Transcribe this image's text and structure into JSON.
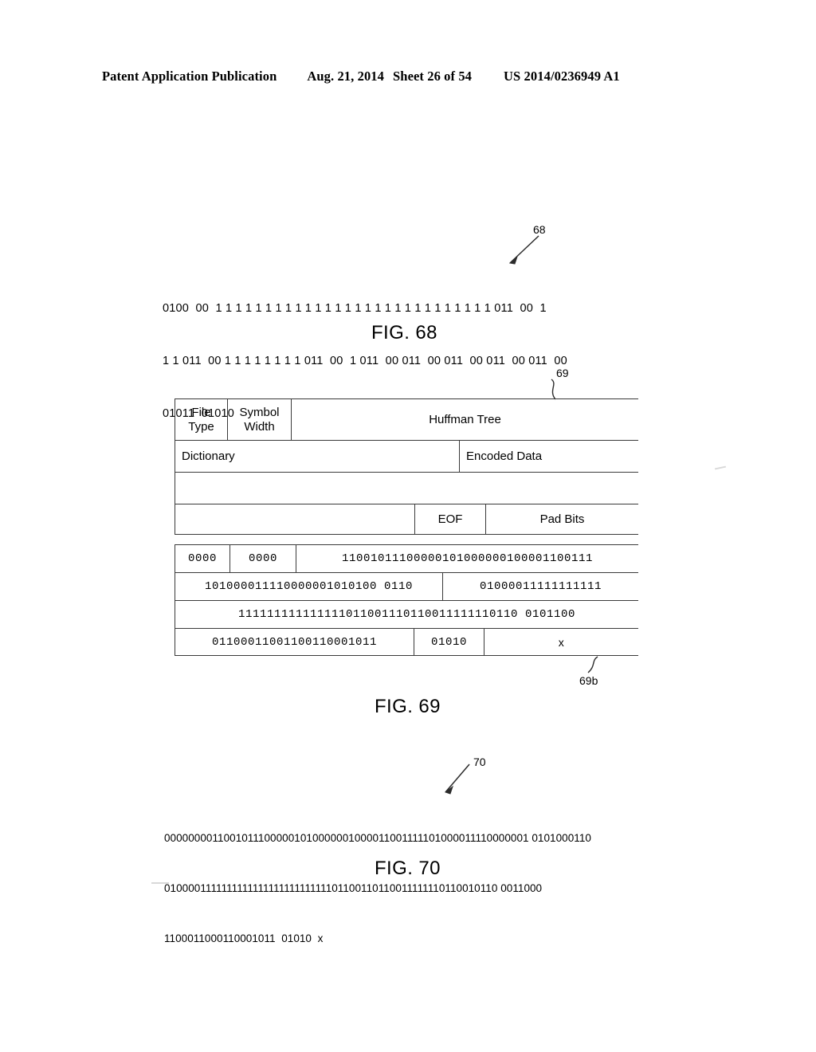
{
  "header": {
    "publication": "Patent Application Publication",
    "date": "Aug. 21, 2014",
    "sheet": "Sheet 26 of 54",
    "patent_number": "US 2014/0236949 A1"
  },
  "figures": [
    {
      "id": "fig68",
      "caption": "FIG. 68",
      "ref_numeral": "68",
      "type": "bit-stream",
      "lines": [
        "0100  00  1 1 1 1 1 1 1 1 1 1 1 1 1 1 1 1 1 1 1 1 1 1 1 1 1 1 1 1 011  00  1",
        "1 1 011  00 1 1 1 1 1 1 1 1 011  00  1 011  00 011  00 011  00 011  00 011  00",
        "01011  01010"
      ]
    },
    {
      "id": "fig69",
      "caption": "FIG. 69",
      "ref_numeral": "69",
      "ref_numeral_b": "69b",
      "type": "packet-structure",
      "structure_labels": {
        "file_type": "File\nType",
        "file_type_line1": "File",
        "file_type_line2": "Type",
        "symbol_width_line1": "Symbol",
        "symbol_width_line2": "Width",
        "huffman_tree": "Huffman Tree",
        "dictionary": "Dictionary",
        "encoded_data": "Encoded Data",
        "eof": "EOF",
        "pad_bits": "Pad Bits"
      },
      "bit_table": {
        "row1": {
          "file_type": "0000",
          "symbol_width": "0000",
          "huffman_tree": "11001011100000101000000100001100111"
        },
        "row2": {
          "dictionary": "101000011110000001010100 0110",
          "encoded_data": "01000011111111111"
        },
        "row3": {
          "continued": "111111111111111011001110110011111110110 0101100"
        },
        "row4": {
          "continued": "01100011001100110001011",
          "eof": "01010",
          "pad_bits": "x"
        }
      }
    },
    {
      "id": "fig70",
      "caption": "FIG. 70",
      "ref_numeral": "70",
      "type": "bit-stream",
      "lines": [
        "00000000110010111000001010000001000011001111101000011110000001 0101000110",
        "010000111111111111111111111111101100110110011111110110010110 0011000",
        "1100011000110001011  01010  x"
      ]
    }
  ]
}
